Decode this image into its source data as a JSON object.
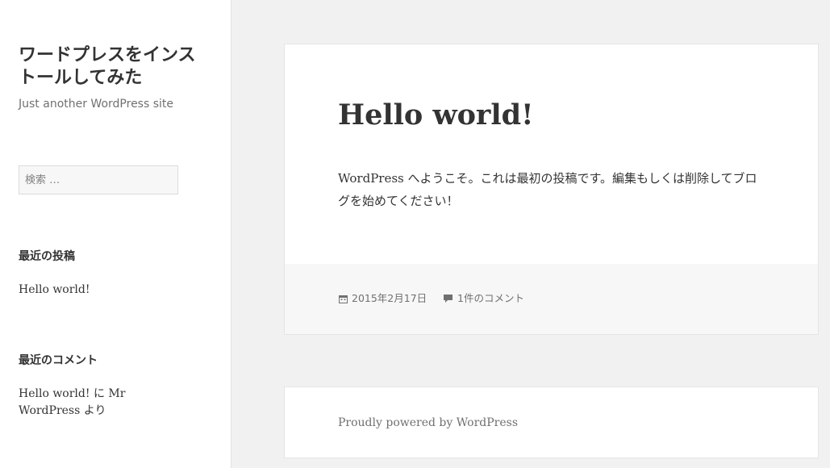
{
  "site": {
    "title": "ワードプレスをインストールしてみた",
    "tagline": "Just another WordPress site"
  },
  "search": {
    "placeholder": "検索 …"
  },
  "widgets": {
    "recent_posts": {
      "title": "最近の投稿",
      "items": [
        "Hello world!"
      ]
    },
    "recent_comments": {
      "title": "最近のコメント",
      "items": [
        {
          "post": "Hello world!",
          "connector": " に ",
          "author": "Mr WordPress",
          "suffix": " より"
        }
      ]
    }
  },
  "post": {
    "title": "Hello world!",
    "content": "WordPress へようこそ。これは最初の投稿です。編集もしくは削除してブログを始めてください！",
    "date": "2015年2月17日",
    "comments": "1件のコメント",
    "date_icon": "calendar-icon",
    "comment_icon": "comment-icon"
  },
  "footer": {
    "credit": "Proudly powered by WordPress"
  },
  "colors": {
    "background": "#f1f1f1",
    "card": "#ffffff",
    "meta_background": "#f7f7f7",
    "text": "#333333",
    "muted": "#707070"
  }
}
